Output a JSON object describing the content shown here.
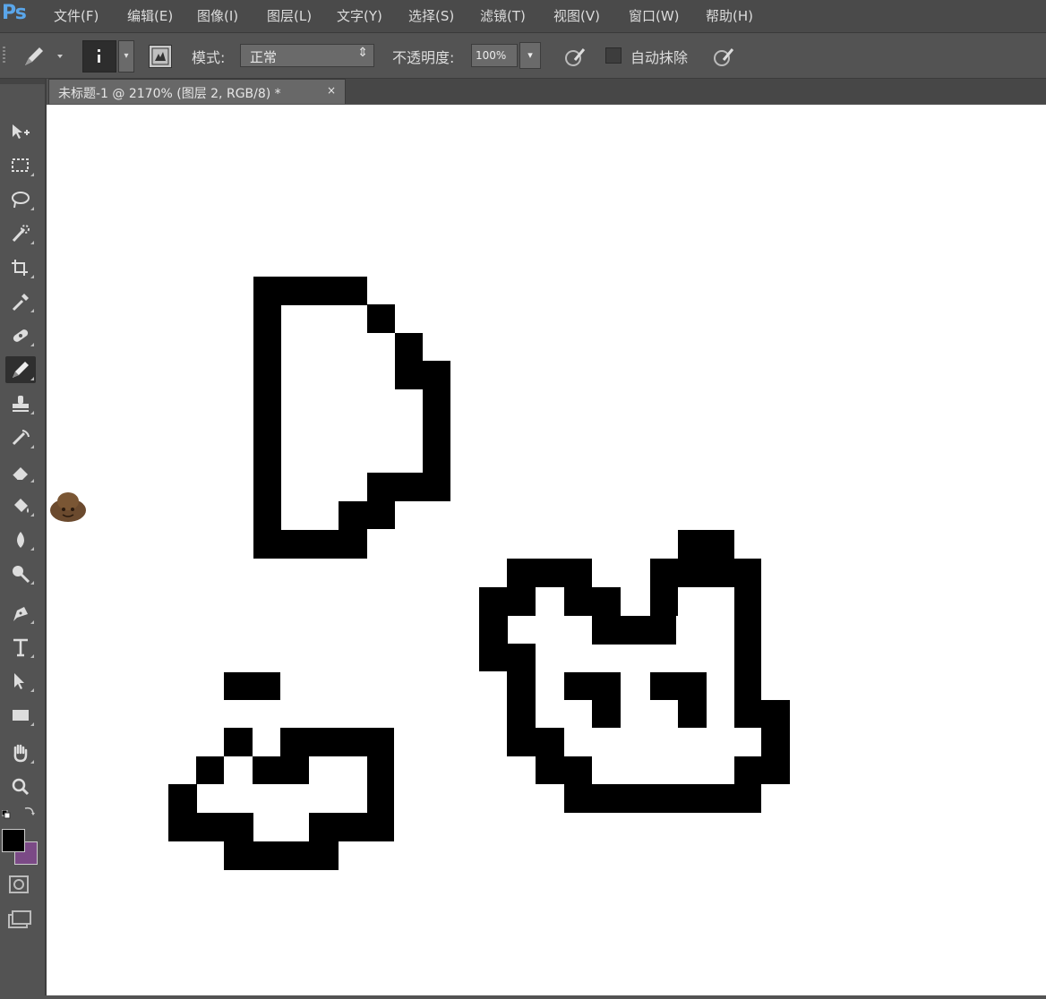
{
  "app": {
    "logo": "Ps"
  },
  "menu": {
    "items": [
      "文件(F)",
      "编辑(E)",
      "图像(I)",
      "图层(L)",
      "文字(Y)",
      "选择(S)",
      "滤镜(T)",
      "视图(V)",
      "窗口(W)",
      "帮助(H)"
    ]
  },
  "options_bar": {
    "mode_label": "模式:",
    "mode_value": "正常",
    "opacity_label": "不透明度:",
    "opacity_value": "100%",
    "auto_erase_label": "自动抹除",
    "auto_erase_checked": false
  },
  "document": {
    "tab_title": "未标题-1 @ 2170% (图层 2, RGB/8) *",
    "close_glyph": "×"
  },
  "colors": {
    "foreground": "#000000",
    "background": "#7b4a86",
    "canvas": "#ffffff",
    "app_bg": "#535353"
  },
  "toolbox": {
    "tools": [
      "move-tool",
      "marquee-tool",
      "lasso-tool",
      "quick-select-tool",
      "crop-tool",
      "eyedropper-tool",
      "healing-brush-tool",
      "pencil-tool",
      "clone-stamp-tool",
      "history-brush-tool",
      "eraser-tool",
      "paint-bucket-tool",
      "blur-tool",
      "dodge-tool",
      "pen-tool",
      "type-tool",
      "path-select-tool",
      "rectangle-tool",
      "hand-tool",
      "zoom-tool"
    ],
    "active_tool": "pencil-tool"
  }
}
